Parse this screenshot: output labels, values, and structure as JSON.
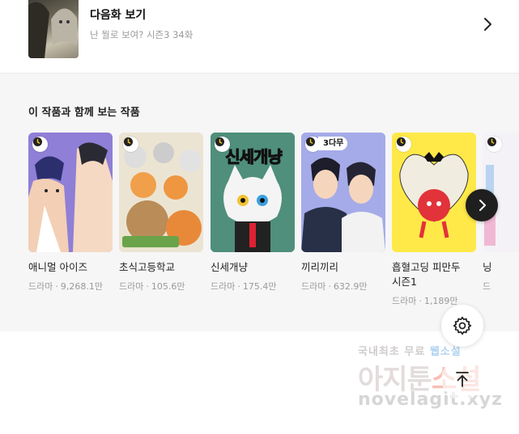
{
  "next_episode": {
    "title": "다음화 보기",
    "subtitle": "난 뭘로 보여? 시즌3 34화"
  },
  "recommend": {
    "heading": "이 작품과 함께 보는 작품",
    "items": [
      {
        "title": "애니멀 아이즈",
        "genre": "드라마",
        "views": "9,268.1만",
        "bg": "#8f7fd6"
      },
      {
        "title": "초식고등학교",
        "genre": "드라마",
        "views": "105.6만",
        "bg": "#f0e8d8"
      },
      {
        "title": "신세개냥",
        "genre": "드라마",
        "views": "175.4만",
        "bg": "#4e8f7c",
        "cover_text": "신세개냥"
      },
      {
        "title": "끼리끼리",
        "genre": "드라마",
        "views": "632.9만",
        "bg": "#9fa6e6",
        "badge": "3다무"
      },
      {
        "title": "흡혈고딩 피만두",
        "title_line2": "시즌1",
        "genre": "드라마",
        "views": "1,189만",
        "bg": "#ffe94a"
      },
      {
        "title": "닝",
        "genre": "드",
        "views": "",
        "bg": "#f3f3f6"
      }
    ]
  },
  "watermark": {
    "line1_a": "국내최초 무료",
    "line1_b": "웹소설",
    "line2_a": "아지툰",
    "line2_b": "소설",
    "line3": "novelagit.xyz"
  },
  "icons": {
    "chevron": "chevron-right-icon",
    "clock": "clock-icon",
    "settings": "gear-icon",
    "top": "arrow-up-icon"
  }
}
